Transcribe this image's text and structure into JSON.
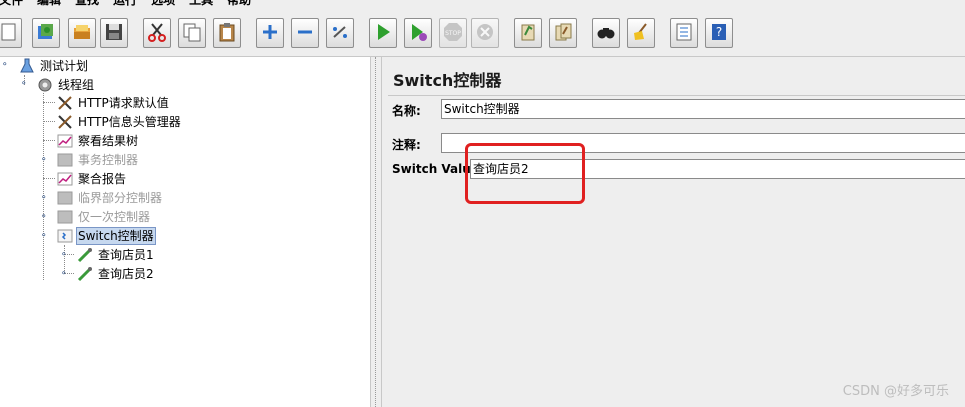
{
  "menu": {
    "items": [
      "文件",
      "编辑",
      "查找",
      "运行",
      "选项",
      "工具",
      "帮助"
    ]
  },
  "toolbar": {
    "buttons": [
      {
        "name": "new-icon"
      },
      {
        "name": "templates-icon"
      },
      {
        "name": "open-icon"
      },
      {
        "name": "save-icon"
      },
      {
        "name": "cut-icon"
      },
      {
        "name": "copy-icon"
      },
      {
        "name": "paste-icon"
      },
      {
        "name": "expand-icon"
      },
      {
        "name": "collapse-icon"
      },
      {
        "name": "toggle-icon"
      },
      {
        "name": "start-icon"
      },
      {
        "name": "start-no-pauses-icon"
      },
      {
        "name": "stop-icon"
      },
      {
        "name": "shutdown-icon"
      },
      {
        "name": "clear-icon"
      },
      {
        "name": "clear-all-icon"
      },
      {
        "name": "search-icon"
      },
      {
        "name": "reset-search-icon"
      },
      {
        "name": "function-helper-icon"
      },
      {
        "name": "help-icon"
      }
    ],
    "stop_label": "STOP"
  },
  "tree": {
    "items": [
      {
        "label": "测试计划",
        "icon": "test-plan-icon",
        "state": "normal"
      },
      {
        "label": "线程组",
        "icon": "thread-group-icon",
        "state": "normal"
      },
      {
        "label": "HTTP请求默认值",
        "icon": "config-tools-icon",
        "state": "normal"
      },
      {
        "label": "HTTP信息头管理器",
        "icon": "config-tools-icon",
        "state": "normal"
      },
      {
        "label": "察看结果树",
        "icon": "listener-graph-icon",
        "state": "normal"
      },
      {
        "label": "事务控制器",
        "icon": "controller-icon",
        "state": "disabled"
      },
      {
        "label": "聚合报告",
        "icon": "listener-graph-icon",
        "state": "normal"
      },
      {
        "label": "临界部分控制器",
        "icon": "controller-icon",
        "state": "disabled"
      },
      {
        "label": "仅一次控制器",
        "icon": "controller-icon",
        "state": "disabled"
      },
      {
        "label": "Switch控制器",
        "icon": "switch-controller-icon",
        "state": "selected"
      },
      {
        "label": "查询店员1",
        "icon": "sampler-pipette-icon",
        "state": "normal"
      },
      {
        "label": "查询店员2",
        "icon": "sampler-pipette-icon",
        "state": "normal"
      }
    ]
  },
  "panel": {
    "title": "Switch控制器",
    "name_label": "名称:",
    "name_value": "Switch控制器",
    "comment_label": "注释:",
    "comment_value": "",
    "switch_label": "Switch Value",
    "switch_value": "查询店员2"
  },
  "watermark": "CSDN @好多可乐",
  "colors": {
    "highlight": "#e02020",
    "selection_bg": "#c6d8ef"
  }
}
